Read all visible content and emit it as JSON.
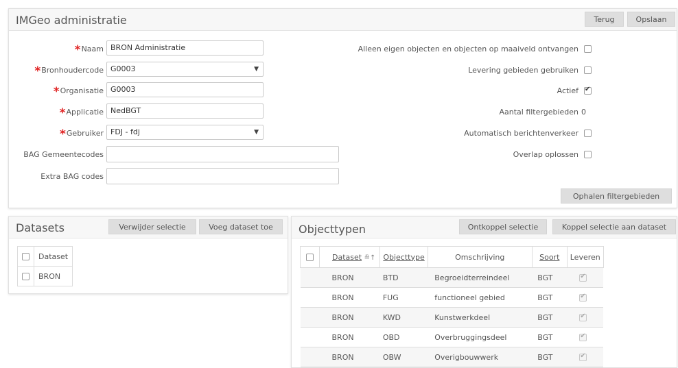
{
  "main_panel": {
    "title": "IMGeo administratie",
    "back_button": "Terug",
    "save_button": "Opslaan",
    "fields": {
      "naam": {
        "label": "Naam",
        "value": "BRON Administratie"
      },
      "bronhoudercode": {
        "label": "Bronhoudercode",
        "value": "G0003"
      },
      "organisatie": {
        "label": "Organisatie",
        "value": "G0003"
      },
      "applicatie": {
        "label": "Applicatie",
        "value": "NedBGT"
      },
      "gebruiker": {
        "label": "Gebruiker",
        "value": "FDJ - fdj"
      },
      "bag_gemeentecodes": {
        "label": "BAG Gemeentecodes",
        "value": ""
      },
      "extra_bag_codes": {
        "label": "Extra BAG codes",
        "value": ""
      }
    },
    "options": {
      "alleen_eigen": {
        "label": "Alleen eigen objecten en objecten op maaiveld ontvangen",
        "checked": false
      },
      "levering_gebieden": {
        "label": "Levering gebieden gebruiken",
        "checked": false
      },
      "actief": {
        "label": "Actief",
        "checked": true
      },
      "aantal_filtergebieden": {
        "label": "Aantal filtergebieden",
        "value": "0"
      },
      "automatisch_berichten": {
        "label": "Automatisch berichtenverkeer",
        "checked": false
      },
      "overlap_oplossen": {
        "label": "Overlap oplossen",
        "checked": false
      }
    },
    "fetch_button": "Ophalen filtergebieden"
  },
  "datasets_panel": {
    "title": "Datasets",
    "remove_button": "Verwijder selectie",
    "add_button": "Voeg dataset toe",
    "column": "Dataset",
    "rows": [
      "BRON"
    ]
  },
  "objecttypes_panel": {
    "title": "Objecttypen",
    "unlink_button": "Ontkoppel selectie",
    "link_button": "Koppel selectie aan dataset",
    "columns": {
      "dataset": "Dataset",
      "objecttype": "Objecttype",
      "omschrijving": "Omschrijving",
      "soort": "Soort",
      "leveren": "Leveren"
    },
    "rows": [
      {
        "dataset": "BRON",
        "objecttype": "BTD",
        "omschrijving": "Begroeidterreindeel",
        "soort": "BGT"
      },
      {
        "dataset": "BRON",
        "objecttype": "FUG",
        "omschrijving": "functioneel gebied",
        "soort": "BGT"
      },
      {
        "dataset": "BRON",
        "objecttype": "KWD",
        "omschrijving": "Kunstwerkdeel",
        "soort": "BGT"
      },
      {
        "dataset": "BRON",
        "objecttype": "OBD",
        "omschrijving": "Overbruggingsdeel",
        "soort": "BGT"
      },
      {
        "dataset": "BRON",
        "objecttype": "OBW",
        "omschrijving": "Overigbouwwerk",
        "soort": "BGT"
      }
    ]
  }
}
